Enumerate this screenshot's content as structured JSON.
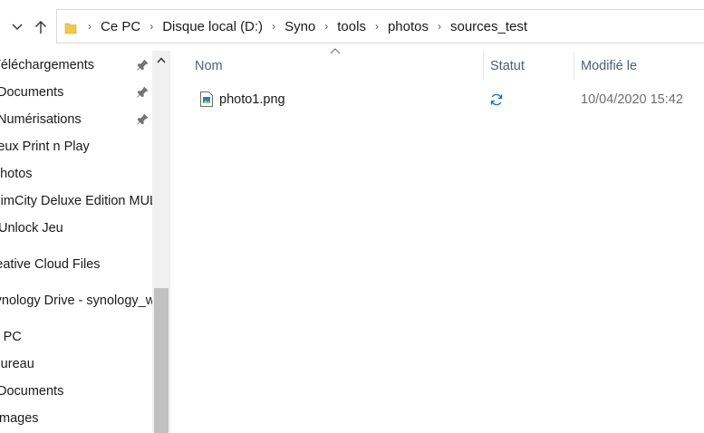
{
  "toolbar": {
    "back_icon": "chevron-down-icon",
    "up_icon": "up-arrow-icon"
  },
  "breadcrumb": {
    "items": [
      "Ce PC",
      "Disque local (D:)",
      "Syno",
      "tools",
      "photos",
      "sources_test"
    ]
  },
  "sidebar": {
    "items": [
      {
        "label": "Téléchargements",
        "pinned": true
      },
      {
        "label": "Documents",
        "pinned": true
      },
      {
        "label": "Numérisations",
        "pinned": true
      },
      {
        "label": "Jeux Print n Play",
        "pinned": false
      },
      {
        "label": "photos",
        "pinned": false
      },
      {
        "label": "SimCity Deluxe Edition MUL",
        "pinned": false
      },
      {
        "label": "Unlock Jeu",
        "pinned": false
      },
      {
        "label": "Creative Cloud Files",
        "pinned": false
      },
      {
        "label": "Synology Drive - synology_w",
        "pinned": false
      },
      {
        "label": "Ce PC",
        "pinned": false
      },
      {
        "label": "Bureau",
        "pinned": false
      },
      {
        "label": "Documents",
        "pinned": false
      },
      {
        "label": "Images",
        "pinned": false
      }
    ]
  },
  "columns": {
    "name": "Nom",
    "status": "Statut",
    "modified": "Modifié le"
  },
  "files": [
    {
      "name": "photo1.png",
      "status_icon": "sync-icon",
      "modified": "10/04/2020 15:42"
    }
  ],
  "colors": {
    "header_text": "#4c607a",
    "sync_blue": "#1a73c8",
    "folder_yellow": "#f3c94b"
  }
}
